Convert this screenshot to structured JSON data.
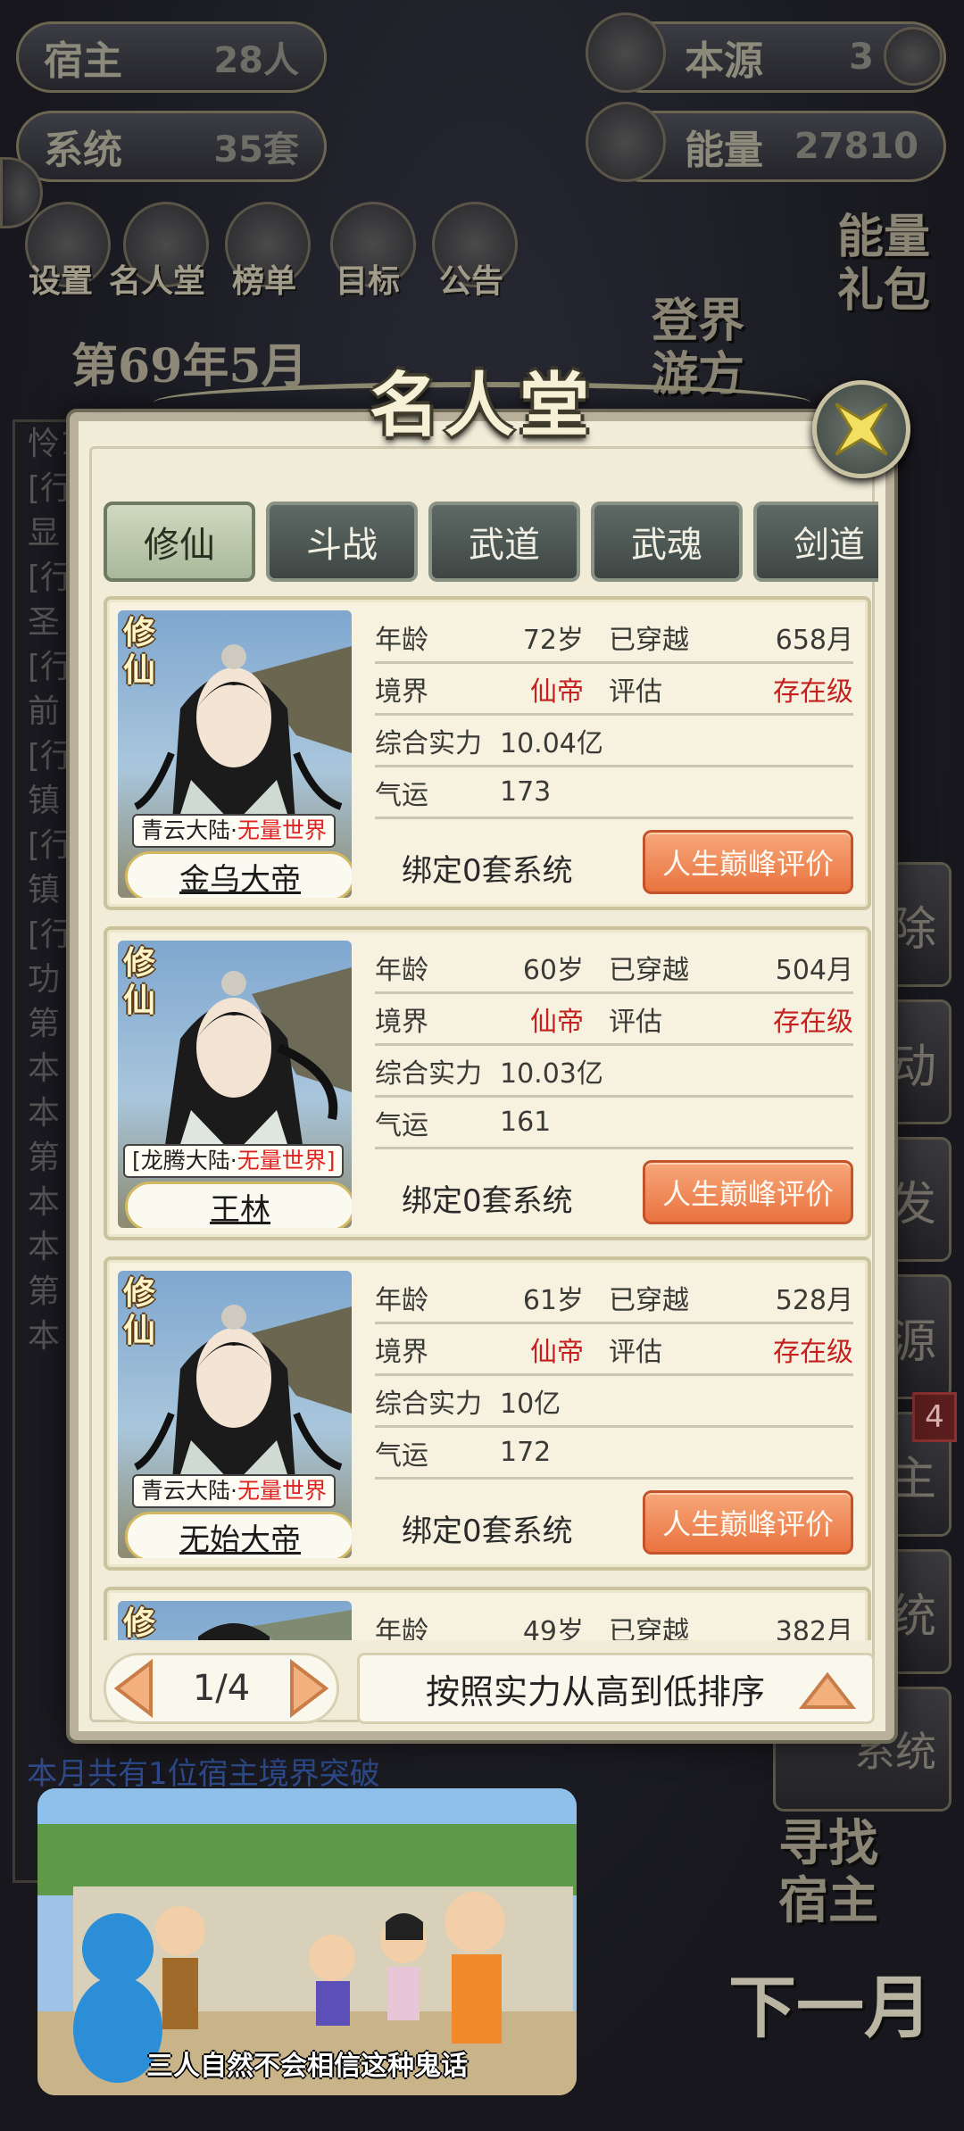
{
  "top_stats": {
    "host": {
      "label": "宿主",
      "value": "28人"
    },
    "system": {
      "label": "系统",
      "value": "35套"
    },
    "origin": {
      "label": "本源",
      "value": "3"
    },
    "energy": {
      "label": "能量",
      "value": "27810"
    }
  },
  "top_icons": [
    "设置",
    "名人堂",
    "榜单",
    "目标",
    "公告"
  ],
  "energy_pack": "能量\n礼包",
  "travel": "登界\n游方",
  "year_banner": "第69年5月",
  "side_buttons": [
    "除",
    "动",
    "发",
    "源",
    "主",
    "统",
    "系统"
  ],
  "side_badge": "4",
  "search_host": "寻找\n宿主",
  "next_month": "下一月",
  "bottom_status": "本月共有1位宿主境界突破",
  "log_lines": [
    "怜1",
    "[行",
    "显",
    "[行",
    "圣",
    "[行",
    "前",
    "[行",
    "镇",
    "[行",
    "镇",
    "[行",
    "功",
    "第",
    "本",
    "本",
    "第",
    "本",
    "本",
    "第",
    "本"
  ],
  "modal": {
    "title": "名人堂",
    "tabs": [
      "修仙",
      "斗战",
      "武道",
      "武魂",
      "剑道"
    ],
    "active_tab": 0,
    "labels": {
      "age": "年龄",
      "crossed": "已穿越",
      "realm": "境界",
      "assess": "评估",
      "power": "综合实力",
      "luck": "气运",
      "peak_button": "人生巅峰评价",
      "cult_tag": "修仙"
    },
    "cards": [
      {
        "name": "金乌大帝",
        "origin_world": "青云大陆·",
        "origin_tag": "无量世界",
        "age": "72岁",
        "crossed": "658月",
        "realm": "仙帝",
        "assess": "存在级",
        "power": "10.04亿",
        "luck": "173",
        "bound": "绑定0套系统"
      },
      {
        "name": "王林",
        "origin_world": "[龙腾大陆·",
        "origin_tag": "无量世界]",
        "age": "60岁",
        "crossed": "504月",
        "realm": "仙帝",
        "assess": "存在级",
        "power": "10.03亿",
        "luck": "161",
        "bound": "绑定0套系统"
      },
      {
        "name": "无始大帝",
        "origin_world": "青云大陆·",
        "origin_tag": "无量世界",
        "age": "61岁",
        "crossed": "528月",
        "realm": "仙帝",
        "assess": "存在级",
        "power": "10亿",
        "luck": "172",
        "bound": "绑定0套系统"
      },
      {
        "name": "",
        "origin_world": "",
        "origin_tag": "",
        "age": "49岁",
        "crossed": "382月",
        "realm": "",
        "assess": "",
        "power": "",
        "luck": "",
        "bound": ""
      }
    ],
    "pager": "1/4",
    "sort_label": "按照实力从高到低排序"
  },
  "video": {
    "subtitle": "三人自然不会相信这种鬼话"
  },
  "colors": {
    "accent_red": "#c42020",
    "peak_button": "#e9733f",
    "tab_active": "#bcc9aa"
  }
}
